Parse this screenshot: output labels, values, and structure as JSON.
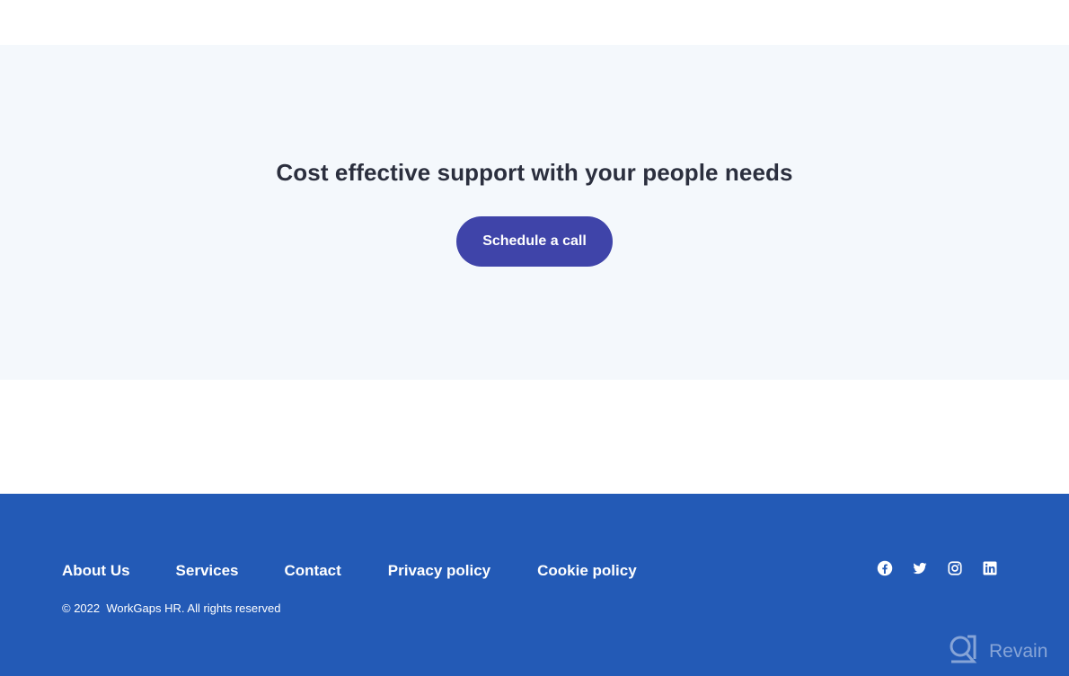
{
  "cta": {
    "title": "Cost effective support with your people needs",
    "button_label": "Schedule a call"
  },
  "footer": {
    "links": [
      {
        "label": "About Us"
      },
      {
        "label": "Services"
      },
      {
        "label": "Contact"
      },
      {
        "label": "Privacy policy"
      },
      {
        "label": "Cookie policy"
      }
    ],
    "copyright": "© 2022  WorkGaps HR. All rights reserved",
    "socials": [
      {
        "icon": "facebook-icon"
      },
      {
        "icon": "twitter-icon"
      },
      {
        "icon": "instagram-icon"
      },
      {
        "icon": "linkedin-icon"
      }
    ]
  },
  "watermark": {
    "label": "Revain",
    "icon": "revain-logo-icon"
  },
  "colors": {
    "cta_background": "#f4f8fc",
    "button": "#3f44a9",
    "footer": "#235ab6",
    "title_text": "#2b2f3e"
  }
}
